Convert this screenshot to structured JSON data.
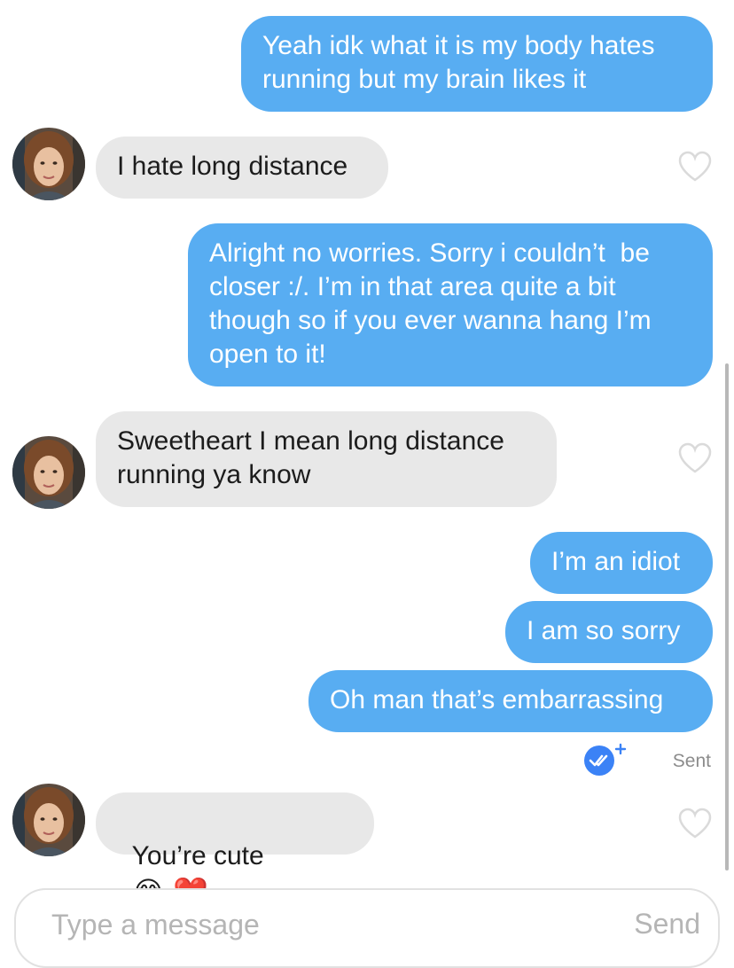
{
  "messages": [
    {
      "dir": "out",
      "text": "Yeah idk what it is my body hates\nrunning but my brain likes it"
    },
    {
      "dir": "in",
      "text": "I hate long distance"
    },
    {
      "dir": "out",
      "text": "Alright no worries. Sorry i couldn’t  be\ncloser :/. I’m in that area quite a bit\nthough so if you ever wanna hang I’m\nopen to it!"
    },
    {
      "dir": "in",
      "text": "Sweetheart I mean long distance\nrunning ya know"
    },
    {
      "dir": "out",
      "text": "I’m an idiot"
    },
    {
      "dir": "out",
      "text": "I am so sorry"
    },
    {
      "dir": "out",
      "text": "Oh man that’s embarrassing"
    },
    {
      "dir": "in",
      "text": "You’re cute",
      "emojis": "😂 ❤️"
    }
  ],
  "status": {
    "sent_label": "Sent",
    "icon": "double-check-boost-icon"
  },
  "composer": {
    "placeholder": "Type a message",
    "send_label": "Send"
  },
  "colors": {
    "outgoing": "#58adf2",
    "incoming": "#e8e8e8",
    "check": "#3b82f6"
  }
}
